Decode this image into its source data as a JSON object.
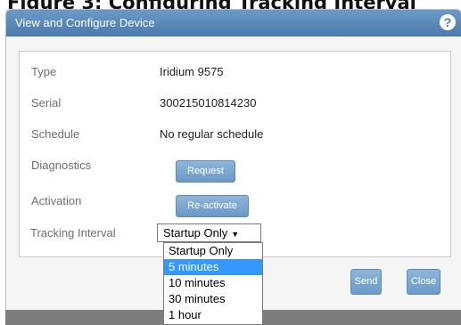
{
  "figure_caption": "Figure 3: Configuring Tracking Interval",
  "dialog": {
    "title": "View and Configure Device",
    "help_icon": "question-mark-icon",
    "help_glyph": "?"
  },
  "rows": {
    "type": {
      "label": "Type",
      "value": "Iridium 9575"
    },
    "serial": {
      "label": "Serial",
      "value": "300215010814230"
    },
    "schedule": {
      "label": "Schedule",
      "value": "No regular schedule"
    },
    "diagnostics": {
      "label": "Diagnostics",
      "button": "Request"
    },
    "activation": {
      "label": "Activation",
      "button": "Re-activate"
    },
    "tracking_interval": {
      "label": "Tracking Interval",
      "selected": "Startup Only"
    }
  },
  "dropdown": {
    "options": [
      "Startup Only",
      "5 minutes",
      "10 minutes",
      "30 minutes",
      "1 hour"
    ],
    "highlighted": "5 minutes"
  },
  "footer": {
    "send_label": "Send",
    "close_label": "Close"
  },
  "colors": {
    "header": "#5b8bba",
    "button": "#7aa6d0",
    "highlight": "#3399ff"
  }
}
